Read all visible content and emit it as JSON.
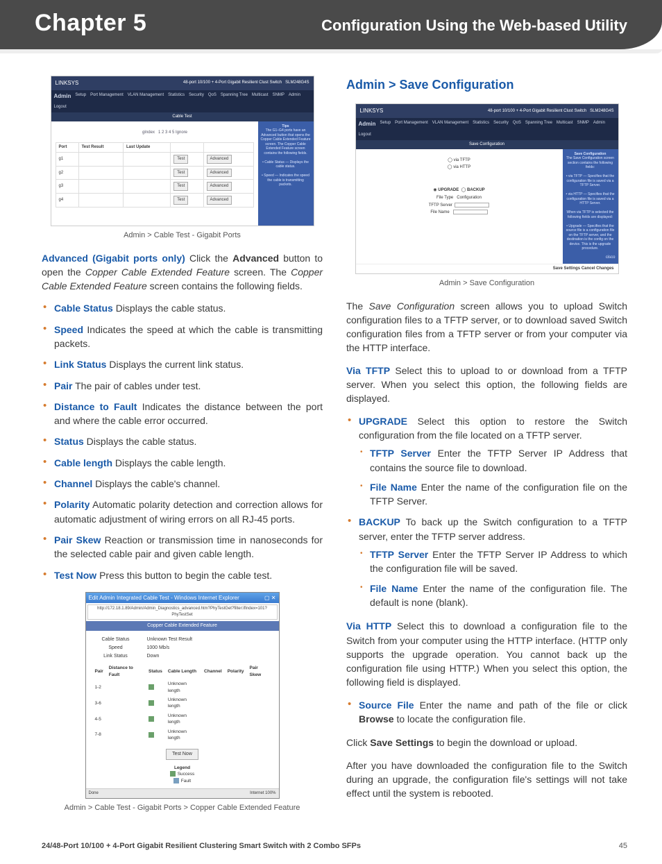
{
  "header": {
    "chapter": "Chapter 5",
    "title": "Configuration Using the Web-based Utility"
  },
  "fig1": {
    "brand": "LINKSYS",
    "section": "Admin",
    "nav": [
      "Setup",
      "Port Management",
      "VLAN Management",
      "Statistics",
      "Security",
      "QoS",
      "Spanning Tree",
      "Multicast",
      "SNMP",
      "Admin",
      "Logout"
    ],
    "subnav": "Cable Test",
    "gindex_label": "gIndex",
    "gindex_values": "1  2  3  4  5  Ignore",
    "th_port": "Port",
    "th_result": "Test Result",
    "th_update": "Last Update",
    "rows": [
      "g1",
      "g2",
      "g3",
      "g4"
    ],
    "btn_test": "Test",
    "btn_adv": "Advanced",
    "help_title": "Tips",
    "caption": "Admin > Cable Test - Gigabit Ports"
  },
  "para_advanced": {
    "lead": "Advanced (Gigabit ports only)",
    "rest_a": " Click the ",
    "bold_a": "Advanced",
    "rest_b": " button to open the ",
    "ital_a": "Copper Cable Extended Feature",
    "rest_c": " screen. The ",
    "ital_b": "Copper Cable Extended Feature",
    "rest_d": " screen contains the following fields."
  },
  "bullets1": [
    {
      "term": "Cable Status",
      "text": "  Displays the cable status."
    },
    {
      "term": "Speed",
      "text": " Indicates the speed at which the cable is transmitting packets."
    },
    {
      "term": "Link Status",
      "text": "  Displays the current link status."
    },
    {
      "term": "Pair",
      "text": "  The pair of cables under test."
    },
    {
      "term": "Distance to Fault",
      "text": "  Indicates the distance between the port and where the cable error occurred."
    },
    {
      "term": "Status",
      "text": "  Displays the cable status."
    },
    {
      "term": "Cable length",
      "text": "   Displays the cable length."
    },
    {
      "term": "Channel",
      "text": "   Displays the cable's channel."
    },
    {
      "term": "Polarity",
      "text": "  Automatic polarity detection and correction allows for automatic adjustment of wiring errors on all RJ-45 ports."
    },
    {
      "term": "Pair Skew",
      "text": " Reaction or transmission time in nanoseconds for the selected cable pair and given cable length."
    },
    {
      "term": "Test Now",
      "text": "   Press this button to begin the cable test."
    }
  ],
  "dialog": {
    "title": "Edit Admin Integrated Cable Test - Windows Internet Explorer",
    "url": "http://172.18.1.89/Admin/Admin_Diagnostics_advanced.htm?PhyTestGet?filter:ifIndex=101?PhyTestSet",
    "bar": "Copper Cable Extended Feature",
    "rows": [
      {
        "lbl": "Cable Status",
        "val": "Unknown Test Result"
      },
      {
        "lbl": "Speed",
        "val": "1000 Mb/s"
      },
      {
        "lbl": "Link Status",
        "val": "Down"
      }
    ],
    "th": [
      "Pair",
      "Distance to Fault",
      "Status",
      "Cable Length",
      "Channel",
      "Polarity",
      "Pair Skew"
    ],
    "trs": [
      {
        "p": "1-2",
        "s": "Unknown length"
      },
      {
        "p": "3-6",
        "s": "Unknown length"
      },
      {
        "p": "4-5",
        "s": "Unknown length"
      },
      {
        "p": "7-8",
        "s": "Unknown length"
      }
    ],
    "btn": "Test Now",
    "legend": "Legend",
    "leg1": "Success",
    "leg2": "Fault",
    "status_l": "Done",
    "status_r": "Internet      100%",
    "caption": "Admin > Cable Test - Gigabit Ports > Copper Cable Extended Feature"
  },
  "section2": {
    "heading": "Admin > Save Configuration"
  },
  "fig2": {
    "brand": "LINKSYS",
    "section": "Admin",
    "subnav": "Save Configuration",
    "opt_tftp": "via TFTP",
    "opt_http": "via HTTP",
    "opt_upgrade": "UPGRADE",
    "opt_backup": "BACKUP",
    "lbl_filetype": "File Type",
    "val_filetype": "Configuration",
    "lbl_server": "TFTP Server",
    "lbl_filename": "File Name",
    "help_title": "Save Configuration",
    "footer": "Save Settings   Cancel Changes",
    "caption": "Admin > Save Configuration"
  },
  "para_save_intro": "The Save Configuration screen allows you to upload Switch configuration files to a TFTP server, or to download saved Switch configuration files from a TFTP server or from your computer via the HTTP interface.",
  "para_via_tftp": {
    "lead": "Via TFTP",
    "text": "  Select this to upload to or download from a TFTP server. When you select this option, the following fields are displayed."
  },
  "bullets2": [
    {
      "term": "UPGRADE",
      "text": " Select this option to restore the Switch configuration from the file located on a TFTP server.",
      "sub": [
        {
          "term": "TFTP Server",
          "text": "  Enter the TFTP Server IP Address that contains the source file to download."
        },
        {
          "term": "File Name",
          "text": "   Enter the name of the configuration file on the TFTP Server."
        }
      ]
    },
    {
      "term": "BACKUP",
      "text": " To back up the Switch configuration to a TFTP server, enter the TFTP server address.",
      "sub": [
        {
          "term": "TFTP Server",
          "text": "  Enter the TFTP Server IP Address to which the configuration file will be saved."
        },
        {
          "term": "File Name",
          "text": "  Enter the name of the configuration file. The default is none (blank)."
        }
      ]
    }
  ],
  "para_via_http": {
    "lead": "Via HTTP",
    "text": "  Select this to download a configuration file to the Switch from your computer using the HTTP interface. (HTTP only supports the upgrade operation. You cannot back up the configuration file using HTTP.) When you select this option, the following field is displayed."
  },
  "bullets3": [
    {
      "term": "Source File",
      "text": "  Enter the name and path of the file or click Browse to locate the configuration file."
    }
  ],
  "para_click_save": {
    "a": "Click ",
    "b": "Save Settings",
    "c": " to begin the download or upload."
  },
  "para_after": "After you have downloaded the configuration file to the Switch during an upgrade, the configuration file's settings will not take effect until the system is rebooted.",
  "footer": {
    "manual": "24/48-Port 10/100 + 4-Port Gigabit Resilient Clustering Smart Switch with 2 Combo SFPs",
    "page": "45"
  }
}
